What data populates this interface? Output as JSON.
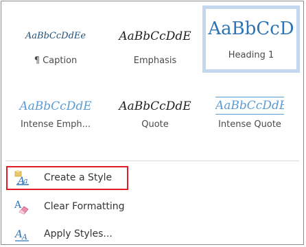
{
  "styles_gallery": {
    "tiles": [
      {
        "sample": "AaBbCcDdEe",
        "name": "¶ Caption"
      },
      {
        "sample": "AaBbCcDdE",
        "name": "Emphasis"
      },
      {
        "sample": "AaBbCcD",
        "name": "Heading 1"
      },
      {
        "sample": "AaBbCcDdE",
        "name": "Intense Emph..."
      },
      {
        "sample": "AaBbCcDdE",
        "name": "Quote"
      },
      {
        "sample": "AaBbCcDdE",
        "name": "Intense Quote"
      }
    ],
    "selected_index": 2
  },
  "menu": {
    "items": [
      {
        "label": "Create a Style",
        "icon": "create-style-icon"
      },
      {
        "label": "Clear Formatting",
        "icon": "clear-formatting-icon"
      },
      {
        "label": "Apply Styles...",
        "icon": "apply-styles-icon"
      }
    ]
  },
  "colors": {
    "highlight_border": "#e01b24",
    "selected_tile_border": "#c5d7ec",
    "heading_blue": "#2e74b5"
  }
}
